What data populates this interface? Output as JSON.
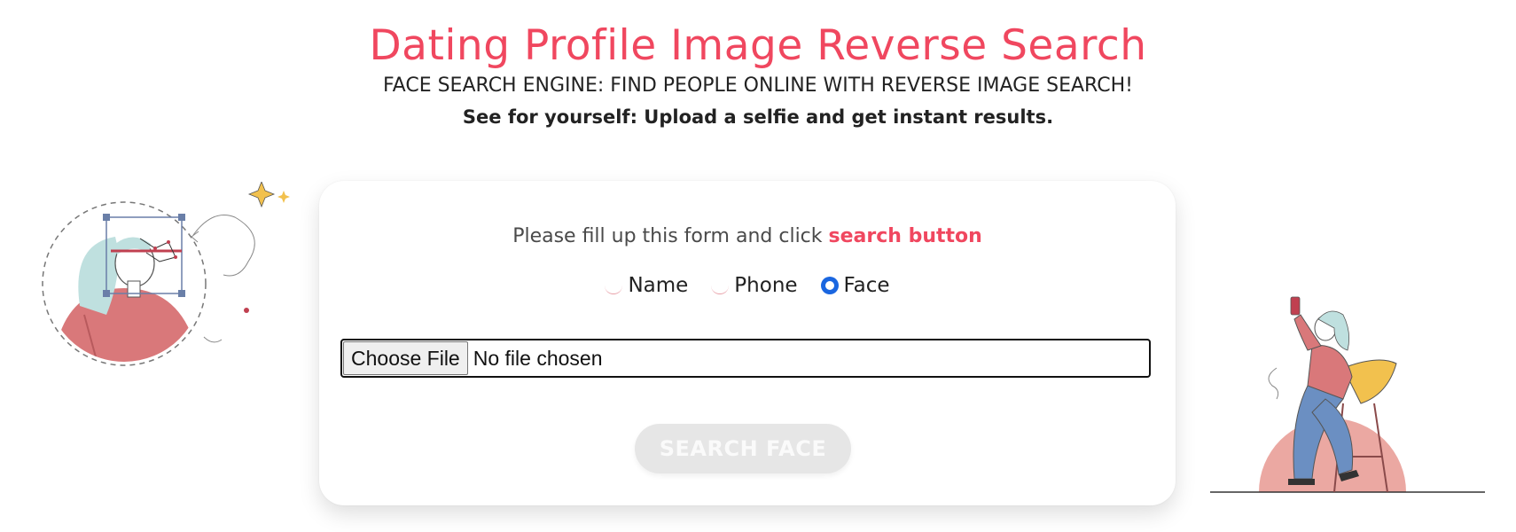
{
  "colors": {
    "accent": "#f0475f",
    "radio_checked": "#1a66e0",
    "button_bg": "#e6e6e6"
  },
  "header": {
    "title": "Dating Profile Image Reverse Search",
    "subtitle": "FACE SEARCH ENGINE: FIND PEOPLE ONLINE WITH REVERSE IMAGE SEARCH!",
    "tagline": "See for yourself: Upload a selfie and get instant results."
  },
  "form": {
    "instruction_prefix": "Please fill up this form and click ",
    "instruction_highlight": "search button",
    "search_types": [
      {
        "label": "Name",
        "checked": false
      },
      {
        "label": "Phone",
        "checked": false
      },
      {
        "label": "Face",
        "checked": true
      }
    ],
    "file_input": {
      "button_label": "Choose File",
      "status": "No file chosen"
    },
    "submit_label": "SEARCH FACE"
  }
}
